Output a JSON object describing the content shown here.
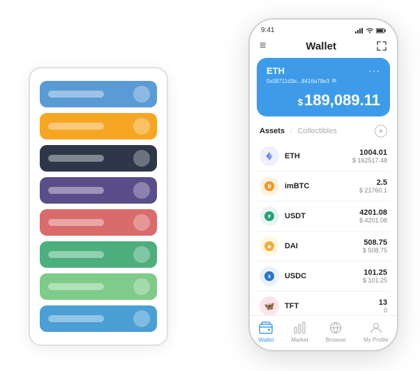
{
  "scene": {
    "card_stack": {
      "cards": [
        {
          "color": "card-blue",
          "label": "",
          "has_dot": true
        },
        {
          "color": "card-orange",
          "label": "",
          "has_dot": true
        },
        {
          "color": "card-dark",
          "label": "",
          "has_dot": true
        },
        {
          "color": "card-purple",
          "label": "",
          "has_dot": true
        },
        {
          "color": "card-red",
          "label": "",
          "has_dot": true
        },
        {
          "color": "card-green",
          "label": "",
          "has_dot": true
        },
        {
          "color": "card-light-green",
          "label": "",
          "has_dot": true
        },
        {
          "color": "card-sky",
          "label": "",
          "has_dot": true
        }
      ]
    },
    "phone": {
      "status_bar": {
        "time": "9:41",
        "signal": "●●●",
        "wifi": "WiFi",
        "battery": "🔋"
      },
      "header": {
        "menu_icon": "≡",
        "title": "Wallet",
        "expand_icon": "⤢"
      },
      "eth_card": {
        "label": "ETH",
        "dots": "···",
        "address": "0x08711d3e...8416a78e3",
        "copy_icon": "⧉",
        "currency": "$",
        "amount": "189,089.11"
      },
      "assets_section": {
        "tab_active": "Assets",
        "tab_divider": "/",
        "tab_inactive": "Collectibles",
        "add_icon": "+"
      },
      "assets": [
        {
          "symbol": "ETH",
          "icon_color": "#627eea",
          "icon_text": "♦",
          "amount": "1004.01",
          "usd": "$ 162517.48"
        },
        {
          "symbol": "imBTC",
          "icon_color": "#f7931a",
          "icon_text": "₿",
          "amount": "2.5",
          "usd": "$ 21760.1"
        },
        {
          "symbol": "USDT",
          "icon_color": "#26a17b",
          "icon_text": "₮",
          "amount": "4201.08",
          "usd": "$ 4201.08"
        },
        {
          "symbol": "DAI",
          "icon_color": "#f5ac37",
          "icon_text": "◈",
          "amount": "508.75",
          "usd": "$ 508.75"
        },
        {
          "symbol": "USDC",
          "icon_color": "#2775ca",
          "icon_text": "©",
          "amount": "101.25",
          "usd": "$ 101.25"
        },
        {
          "symbol": "TFT",
          "icon_color": "#e8395e",
          "icon_text": "🦋",
          "amount": "13",
          "usd": "0"
        }
      ],
      "bottom_nav": [
        {
          "label": "Wallet",
          "active": true
        },
        {
          "label": "Market",
          "active": false
        },
        {
          "label": "Browser",
          "active": false
        },
        {
          "label": "My Profile",
          "active": false
        }
      ]
    }
  }
}
